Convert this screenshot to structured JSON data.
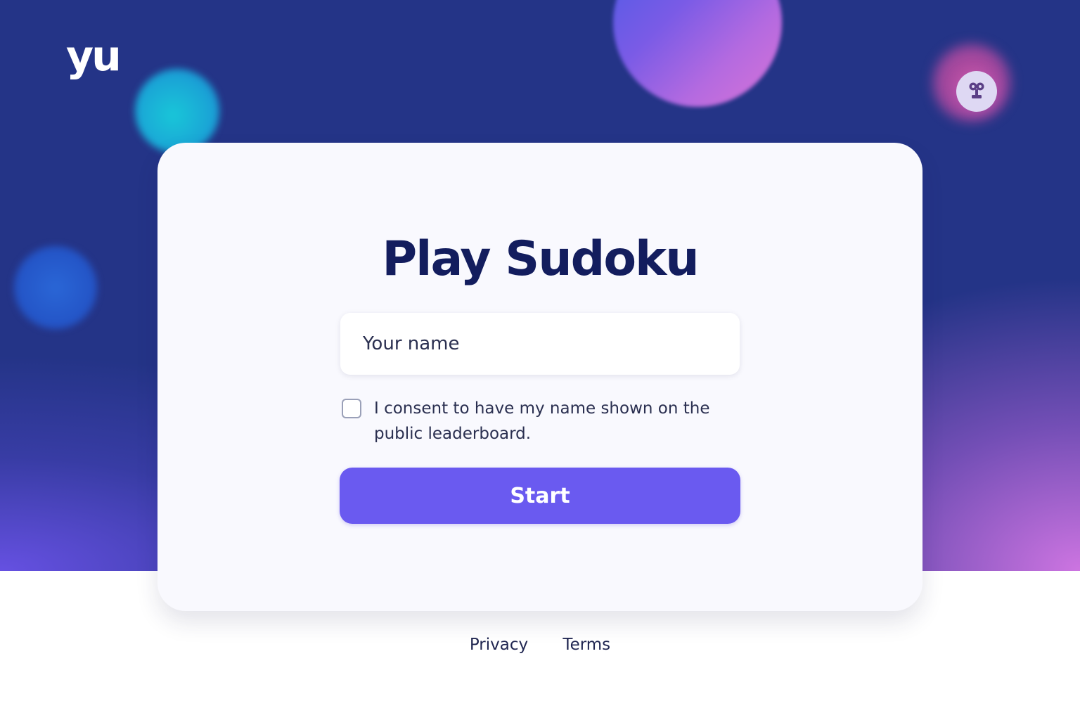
{
  "header": {
    "logo_text": "yu",
    "robot_icon": "robot-icon"
  },
  "card": {
    "title": "Play Sudoku",
    "name_input": {
      "placeholder": "Your name",
      "value": ""
    },
    "consent": {
      "checked": false,
      "label": "I consent to have my name shown on the public leaderboard."
    },
    "start_label": "Start"
  },
  "footer": {
    "links": [
      {
        "label": "Privacy"
      },
      {
        "label": "Terms"
      }
    ]
  },
  "colors": {
    "hero_bg": "#243487",
    "accent": "#6a5af0",
    "title": "#131d5e",
    "card_bg": "#f9f9fe"
  }
}
